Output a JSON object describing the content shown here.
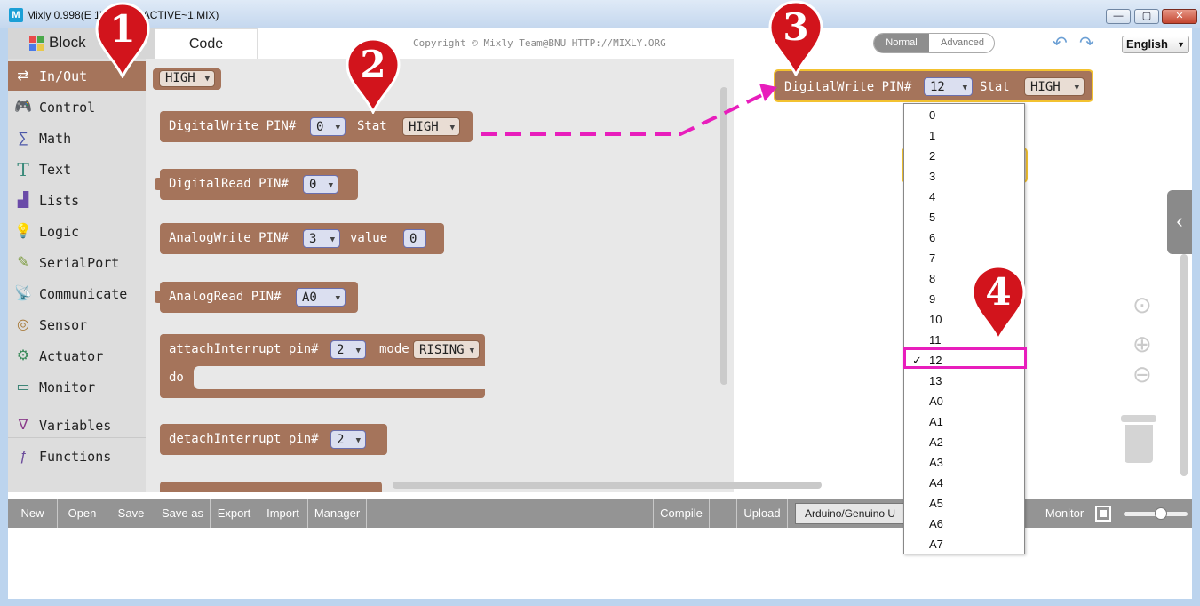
{
  "window": {
    "app_icon": "M",
    "title": "Mixly 0.998(E           1\\lesson7\\ACTIVE~1.MIX)",
    "minimize": "—",
    "maximize": "▢",
    "close": "✕"
  },
  "header": {
    "tab_blocks": "Block",
    "tab_code": "Code",
    "copyright": "Copyright © Mixly Team@BNU HTTP://MIXLY.ORG",
    "mode_normal": "Normal",
    "mode_advanced": "Advanced",
    "undo_icon": "↶",
    "redo_icon": "↷",
    "language": "English",
    "language_caret": "▼"
  },
  "sidebar": {
    "items": [
      {
        "label": "In/Out",
        "icon": "⇄",
        "icon_name": "in-out-icon",
        "icon_color": "#ffffff"
      },
      {
        "label": "Control",
        "icon": "🎮",
        "icon_name": "gamepad-icon",
        "icon_color": "#4a8a3a"
      },
      {
        "label": "Math",
        "icon": "∑",
        "icon_name": "math-icon",
        "icon_color": "#4a56a8"
      },
      {
        "label": "Text",
        "icon": "T",
        "icon_name": "text-icon",
        "icon_color": "#3a8a7a"
      },
      {
        "label": "Lists",
        "icon": "▟",
        "icon_name": "lists-icon",
        "icon_color": "#6a4aa8"
      },
      {
        "label": "Logic",
        "icon": "💡",
        "icon_name": "bulb-icon",
        "icon_color": "#5a8ad0"
      },
      {
        "label": "SerialPort",
        "icon": "✎",
        "icon_name": "serial-port-icon",
        "icon_color": "#7a9a3a"
      },
      {
        "label": "Communicate",
        "icon": "📡",
        "icon_name": "antenna-icon",
        "icon_color": "#2a8a5a"
      },
      {
        "label": "Sensor",
        "icon": "◎",
        "icon_name": "sensor-icon",
        "icon_color": "#a87a3a"
      },
      {
        "label": "Actuator",
        "icon": "⚙",
        "icon_name": "actuator-icon",
        "icon_color": "#3a8a5a"
      },
      {
        "label": "Monitor",
        "icon": "▭",
        "icon_name": "monitor-icon",
        "icon_color": "#2a7a6a"
      },
      {
        "label": "Variables",
        "icon": "∇",
        "icon_name": "variables-icon",
        "icon_color": "#8a3a8a"
      },
      {
        "label": "Functions",
        "icon": "ƒ",
        "icon_name": "functions-icon",
        "icon_color": "#6a4a9a"
      }
    ]
  },
  "flyout": {
    "high_value": "HIGH",
    "dw_label": "DigitalWrite PIN#",
    "dw_pin": "0",
    "dw_stat_label": "Stat",
    "dw_stat": "HIGH",
    "dr_label": "DigitalRead PIN#",
    "dr_pin": "0",
    "aw_label": "AnalogWrite PIN#",
    "aw_pin": "3",
    "aw_value_label": "value",
    "aw_value": "0",
    "ar_label": "AnalogRead PIN#",
    "ar_pin": "A0",
    "ai_label": "attachInterrupt pin#",
    "ai_pin": "2",
    "ai_mode_label": "mode",
    "ai_mode": "RISING",
    "ai_do_label": "do",
    "di_label": "detachInterrupt pin#",
    "di_pin": "2",
    "dd_caret": "▼"
  },
  "workspace": {
    "block_label": "DigitalWrite PIN#",
    "block_pin": "12",
    "block_stat_label": "Stat",
    "block_stat": "HIGH",
    "center_icon": "⊙",
    "zoom_in_icon": "⊕",
    "zoom_out_icon": "⊖",
    "side_toggle": "‹"
  },
  "dropdown": {
    "options": [
      "0",
      "1",
      "2",
      "3",
      "4",
      "5",
      "6",
      "7",
      "8",
      "9",
      "10",
      "11",
      "12",
      "13",
      "A0",
      "A1",
      "A2",
      "A3",
      "A4",
      "A5",
      "A6",
      "A7"
    ],
    "selected_index": 12,
    "check_mark": "✓"
  },
  "toolbar": {
    "new": "New",
    "open": "Open",
    "save": "Save",
    "save_as": "Save as",
    "export": "Export",
    "import": "Import",
    "manager": "Manager",
    "compile": "Compile",
    "upload": "Upload",
    "board": "Arduino/Genuino U",
    "monitor": "Monitor",
    "volume_fraction": 0.5
  },
  "annotations": {
    "marker_1": "1",
    "marker_2": "2",
    "marker_3": "3",
    "marker_4": "4"
  },
  "colors": {
    "block": "#a5745b",
    "highlight": "#e81ebc",
    "marker": "#d2141c",
    "selection_outline": "#f3c230"
  }
}
